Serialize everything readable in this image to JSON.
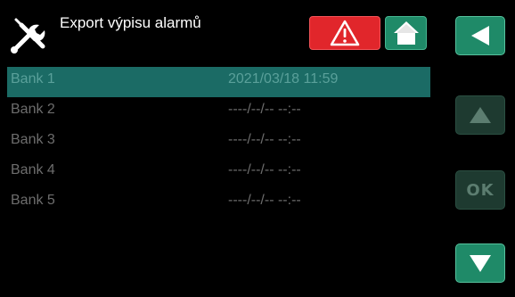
{
  "header": {
    "title": "Export výpisu alarmů",
    "alarm_color": "#e1262b",
    "home_color": "#1f8a68"
  },
  "banks": [
    {
      "name": "Bank 1",
      "date": "2021/03/18 11:59",
      "selected": true
    },
    {
      "name": "Bank 2",
      "date": "----/--/-- --:--",
      "selected": false
    },
    {
      "name": "Bank 3",
      "date": "----/--/-- --:--",
      "selected": false
    },
    {
      "name": "Bank 4",
      "date": "----/--/-- --:--",
      "selected": false
    },
    {
      "name": "Bank 5",
      "date": "----/--/-- --:--",
      "selected": false
    }
  ],
  "sidebar": {
    "ok_label": "OK",
    "back_icon": "triangle-left-icon",
    "up_icon": "triangle-up-icon",
    "down_icon": "triangle-down-icon"
  },
  "colors": {
    "accent": "#1f8a68",
    "selected_row": "#1b6b65",
    "alarm": "#e1262b"
  }
}
